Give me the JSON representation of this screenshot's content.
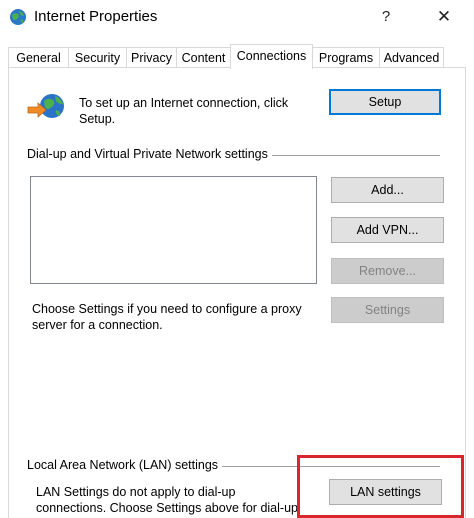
{
  "window": {
    "title": "Internet Properties",
    "help_label": "?",
    "close_label": "✕"
  },
  "tabs": [
    {
      "label": "General"
    },
    {
      "label": "Security"
    },
    {
      "label": "Privacy"
    },
    {
      "label": "Content"
    },
    {
      "label": "Connections",
      "active": true
    },
    {
      "label": "Programs"
    },
    {
      "label": "Advanced"
    }
  ],
  "setup": {
    "text": "To set up an Internet connection, click Setup.",
    "button_label": "Setup"
  },
  "dialup": {
    "group_label": "Dial-up and Virtual Private Network settings",
    "connections": [],
    "add_label": "Add...",
    "add_vpn_label": "Add VPN...",
    "remove_label": "Remove...",
    "settings_label": "Settings",
    "help_text": "Choose Settings if you need to configure a proxy server for a connection."
  },
  "lan": {
    "group_label": "Local Area Network (LAN) settings",
    "note_text": "LAN Settings do not apply to dial-up connections. Choose Settings above for dial-up",
    "button_label": "LAN settings"
  },
  "colors": {
    "highlight": "#d9262e",
    "default_button_border": "#0078d7"
  }
}
